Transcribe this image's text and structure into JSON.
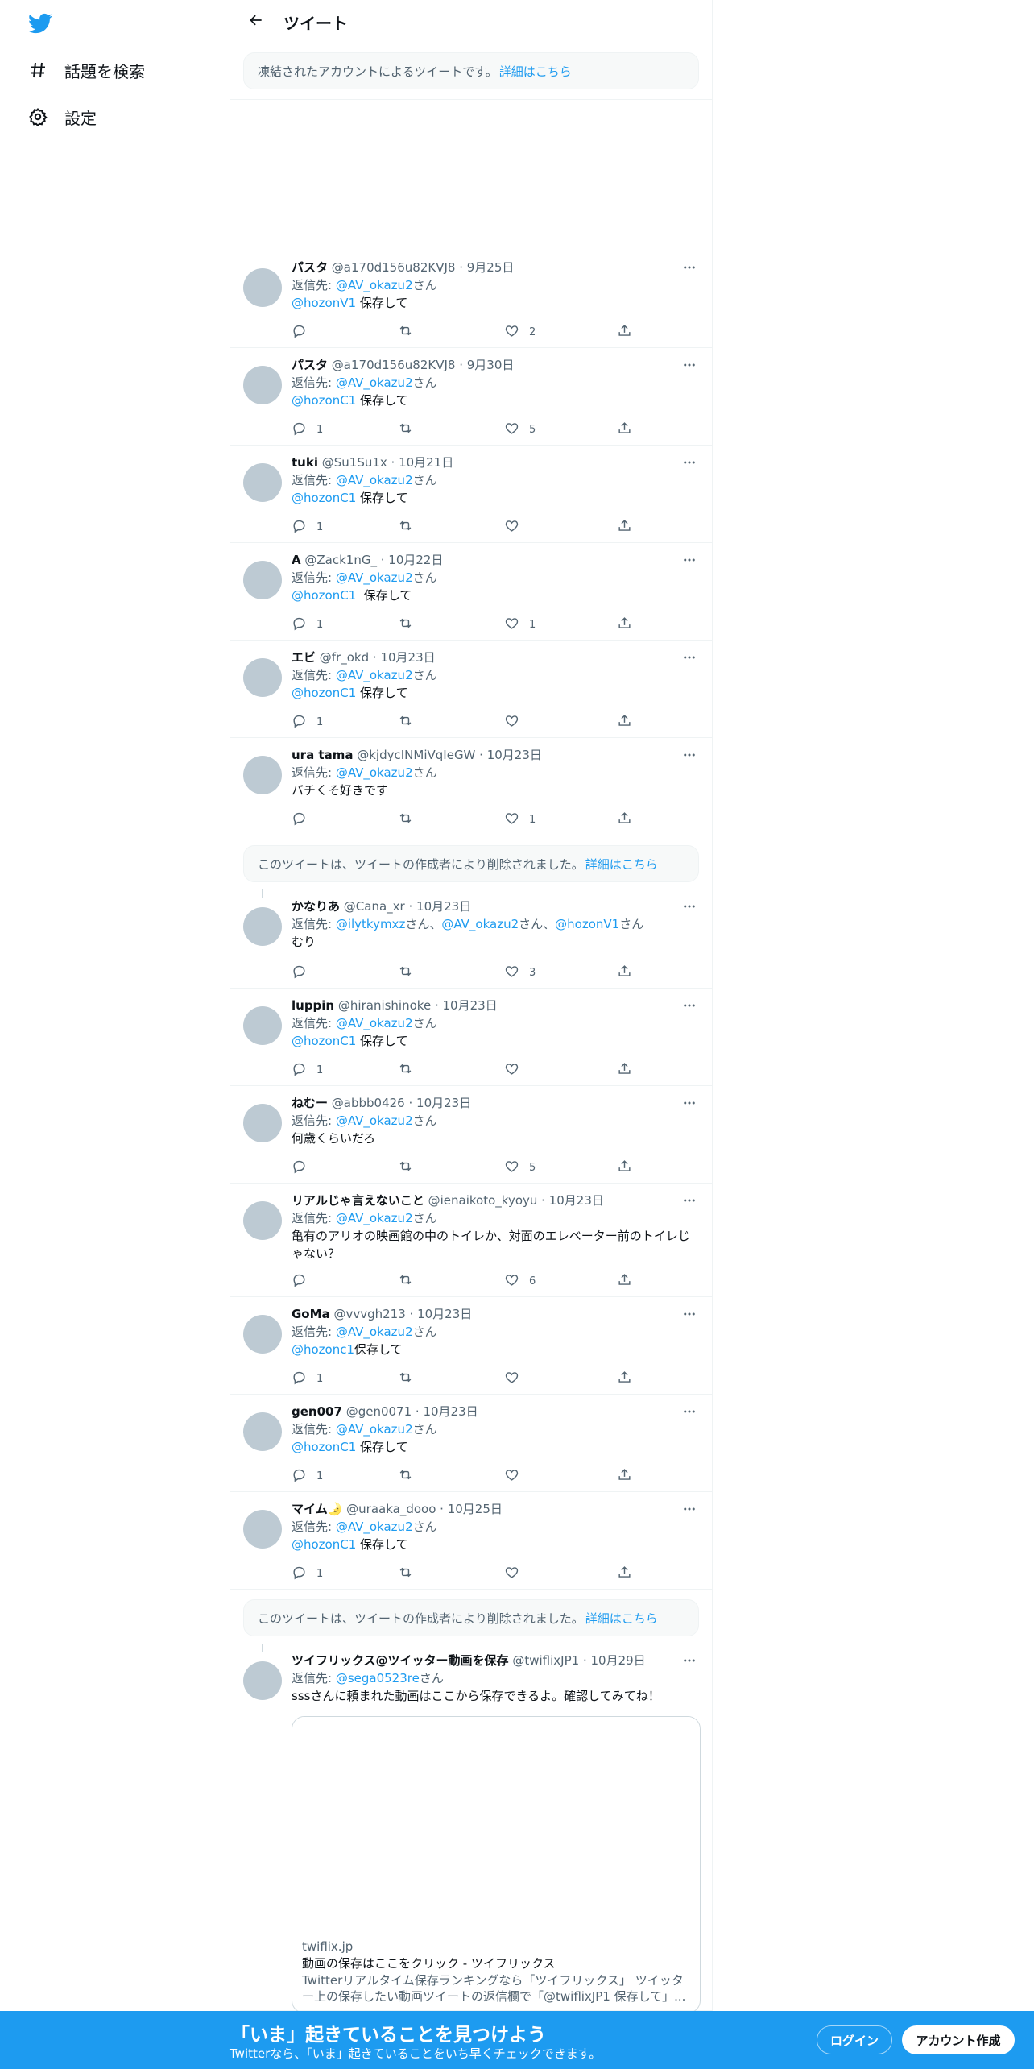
{
  "colors": {
    "accent": "#1d9bf0",
    "text": "#0f1419",
    "muted": "#536471",
    "avatar": "#bdcad3"
  },
  "sidebar": {
    "logo_icon": "twitter-bird-icon",
    "items": [
      {
        "label": "話題を検索",
        "icon": "hashtag-icon"
      },
      {
        "label": "設定",
        "icon": "gear-icon"
      }
    ]
  },
  "header": {
    "title": "ツイート",
    "back_icon": "arrow-left-icon"
  },
  "notices": {
    "frozen": {
      "text": "凍結されたアカウントによるツイートです。",
      "link": "詳細はこちら"
    },
    "deleted1": {
      "text": "このツイートは、ツイートの作成者により削除されました。",
      "link": "詳細はこちら"
    },
    "deleted2": {
      "text": "このツイートは、ツイートの作成者により削除されました。",
      "link": "詳細はこちら"
    }
  },
  "reply_prefix": "返信先: ",
  "san": "さん",
  "tweets": [
    {
      "name": "パスタ",
      "handle": "@a170d156u82KVJ8",
      "date": "9月25日",
      "reply_to": "@AV_okazu2",
      "mention": "@hozonV1",
      "text": " 保存して",
      "replies": "",
      "retweets": "",
      "likes": "2"
    },
    {
      "name": "パスタ",
      "handle": "@a170d156u82KVJ8",
      "date": "9月30日",
      "reply_to": "@AV_okazu2",
      "mention": "@hozonC1",
      "text": " 保存して",
      "replies": "1",
      "retweets": "",
      "likes": "5"
    },
    {
      "name": "tuki",
      "handle": "@Su1Su1x",
      "date": "10月21日",
      "reply_to": "@AV_okazu2",
      "mention": "@hozonC1",
      "text": " 保存して",
      "replies": "1",
      "retweets": "",
      "likes": ""
    },
    {
      "name": "A",
      "handle": "@Zack1nG_",
      "date": "10月22日",
      "reply_to": "@AV_okazu2",
      "mention": "@hozonC1",
      "text": "  保存して",
      "replies": "1",
      "retweets": "",
      "likes": "1"
    },
    {
      "name": "エビ",
      "handle": "@fr_okd",
      "date": "10月23日",
      "reply_to": "@AV_okazu2",
      "mention": "@hozonC1",
      "text": " 保存して",
      "replies": "1",
      "retweets": "",
      "likes": ""
    },
    {
      "name": "ura tama",
      "handle": "@kjdycINMiVqIeGW",
      "date": "10月23日",
      "reply_to": "@AV_okazu2",
      "mention": "",
      "text": "バチくそ好きです",
      "replies": "",
      "retweets": "",
      "likes": "1"
    },
    {
      "name": "かなりあ",
      "handle": "@Cana_xr",
      "date": "10月23日",
      "reply_to_multi": [
        "@ilytkymxz",
        "@AV_okazu2",
        "@hozonV1"
      ],
      "mention": "",
      "text": "むり",
      "replies": "",
      "retweets": "",
      "likes": "3"
    },
    {
      "name": "luppin",
      "handle": "@hiranishinoke",
      "date": "10月23日",
      "reply_to": "@AV_okazu2",
      "mention": "@hozonC1",
      "text": " 保存して",
      "replies": "1",
      "retweets": "",
      "likes": ""
    },
    {
      "name": "ねむー",
      "handle": "@abbb0426",
      "date": "10月23日",
      "reply_to": "@AV_okazu2",
      "mention": "",
      "text": "何歳くらいだろ",
      "replies": "",
      "retweets": "",
      "likes": "5"
    },
    {
      "name": "リアルじゃ言えないこと",
      "handle": "@ienaikoto_kyoyu",
      "date": "10月23日",
      "reply_to": "@AV_okazu2",
      "mention": "",
      "text": "亀有のアリオの映画館の中のトイレか、対面のエレベーター前のトイレじゃない？",
      "replies": "",
      "retweets": "",
      "likes": "6"
    },
    {
      "name": "GoMa",
      "handle": "@vvvgh213",
      "date": "10月23日",
      "reply_to": "@AV_okazu2",
      "mention": "@hozonc1",
      "text": "保存して",
      "replies": "1",
      "retweets": "",
      "likes": ""
    },
    {
      "name": "gen007",
      "handle": "@gen0071",
      "date": "10月23日",
      "reply_to": "@AV_okazu2",
      "mention": "@hozonC1",
      "text": " 保存して",
      "replies": "1",
      "retweets": "",
      "likes": ""
    },
    {
      "name": "マイム🌛",
      "handle": "@uraaka_dooo",
      "date": "10月25日",
      "reply_to": "@AV_okazu2",
      "mention": "@hozonC1",
      "text": " 保存して",
      "replies": "1",
      "retweets": "",
      "likes": ""
    },
    {
      "name": "ツイフリックス@ツイッター動画を保存",
      "handle": "@twiflixJP1",
      "date": "10月29日",
      "reply_to": "@sega0523re",
      "mention": "",
      "text": "sssさんに頼まれた動画はここから保存できるよ。確認してみてね！",
      "replies": "",
      "retweets": "",
      "likes": ""
    }
  ],
  "card": {
    "domain": "twiflix.jp",
    "title": "動画の保存はここをクリック - ツイフリックス",
    "description": "Twitterリアルタイム保存ランキングなら「ツイフリックス」 ツイッター上の保存したい動画ツイートの返信欄で「@twiflixJP1 保存して」..."
  },
  "bottom_bar": {
    "title": "「いま」起きていることを見つけよう",
    "subtitle": "Twitterなら、「いま」起きていることをいち早くチェックできます。",
    "login": "ログイン",
    "signup": "アカウント作成"
  }
}
